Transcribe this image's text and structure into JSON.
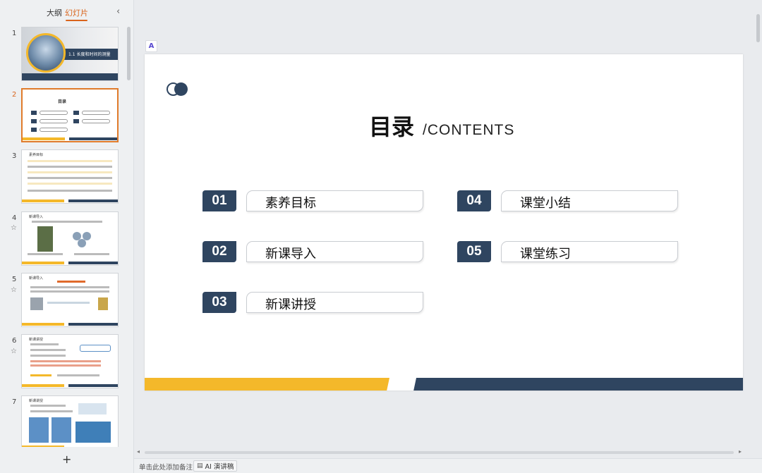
{
  "panel": {
    "tab_outline": "大纲",
    "tab_slides": "幻灯片",
    "collapse": "‹",
    "add": "+"
  },
  "thumbs": [
    {
      "num": "1",
      "text": "1.1 长度和时间的测量"
    },
    {
      "num": "2",
      "text": "目录"
    },
    {
      "num": "3",
      "text": "素养目标"
    },
    {
      "num": "4",
      "text": "新课导入"
    },
    {
      "num": "5",
      "text": "新课导入"
    },
    {
      "num": "6",
      "text": "新课讲授"
    },
    {
      "num": "7",
      "text": "新课讲授"
    }
  ],
  "slide": {
    "title_zh": "目录",
    "title_en": "/CONTENTS",
    "items": [
      {
        "num": "01",
        "label": "素养目标"
      },
      {
        "num": "02",
        "label": "新课导入"
      },
      {
        "num": "03",
        "label": "新课讲授"
      },
      {
        "num": "04",
        "label": "课堂小结"
      },
      {
        "num": "05",
        "label": "课堂练习"
      }
    ]
  },
  "footer": {
    "notes_placeholder": "单击此处添加备注",
    "ai_button": "AI 演讲稿"
  },
  "colors": {
    "accent": "#d9641c",
    "navy": "#2f4560",
    "yellow": "#f4b82a"
  }
}
